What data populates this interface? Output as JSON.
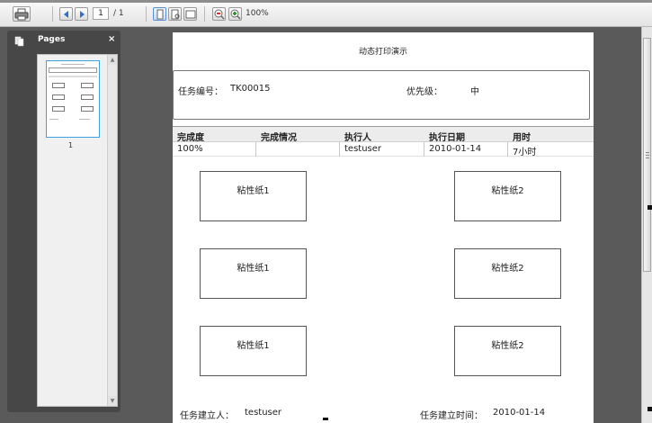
{
  "toolbar": {
    "page_current": "1",
    "page_separator": "/ 1",
    "zoom": "100%"
  },
  "sidebar": {
    "title": "Pages",
    "close": "×",
    "thumbnail_page_number": "1"
  },
  "document": {
    "title": "动态打印演示",
    "task_number_label": "任务编号：",
    "task_number": "TK00015",
    "priority_label": "优先级：",
    "priority": "中",
    "table": {
      "headers": [
        "完成度",
        "完成情况",
        "执行人",
        "执行日期",
        "用时"
      ],
      "row": [
        "100%",
        "",
        "testuser",
        "2010-01-14",
        "7小时"
      ]
    },
    "notes_left": [
      "粘性纸1",
      "粘性纸1",
      "粘性纸1"
    ],
    "notes_right": [
      "粘性纸2",
      "粘性纸2",
      "粘性纸2"
    ],
    "creator_label": "任务建立人：",
    "creator": "testuser",
    "created_time_label": "任务建立时间：",
    "created_time": "2010-01-14"
  },
  "colors": {
    "viewer_background": "#5a5a5a",
    "sidebar_background": "#474747",
    "thumbnail_border": "#3da3e0"
  }
}
